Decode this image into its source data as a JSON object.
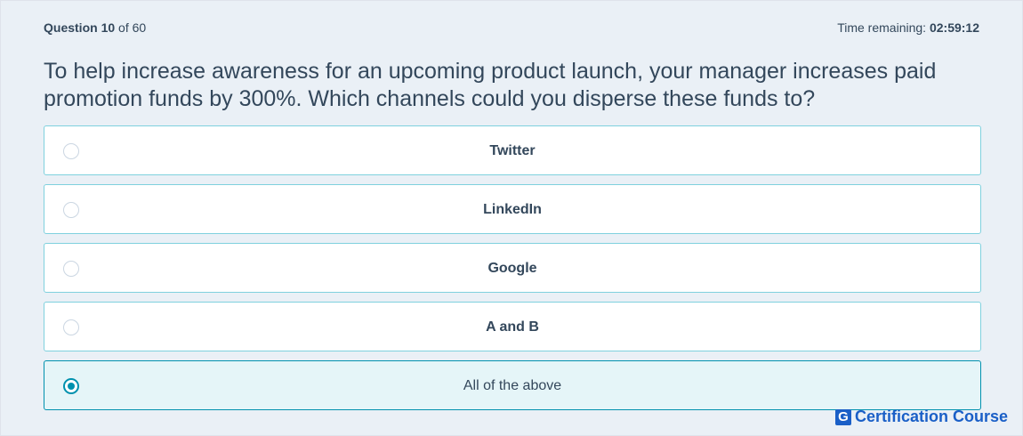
{
  "header": {
    "question_word": "Question",
    "question_number": "10",
    "question_total_text": "of 60",
    "timer_label": "Time remaining:",
    "timer_value": "02:59:12"
  },
  "question": {
    "text": "To help increase awareness for an upcoming product launch, your manager increases paid promotion funds by 300%. Which channels could you disperse these funds to?"
  },
  "options": [
    {
      "label": "Twitter",
      "selected": false
    },
    {
      "label": "LinkedIn",
      "selected": false
    },
    {
      "label": "Google",
      "selected": false
    },
    {
      "label": "A and B",
      "selected": false
    },
    {
      "label": "All of the above",
      "selected": true
    }
  ],
  "brand": {
    "mark": "G",
    "name": "Certification Course"
  },
  "colors": {
    "background": "#eaf0f6",
    "option_border": "#7fd1de",
    "selected_background": "#e5f5f8",
    "accent": "#0091ae",
    "brand": "#1a5fc7"
  }
}
